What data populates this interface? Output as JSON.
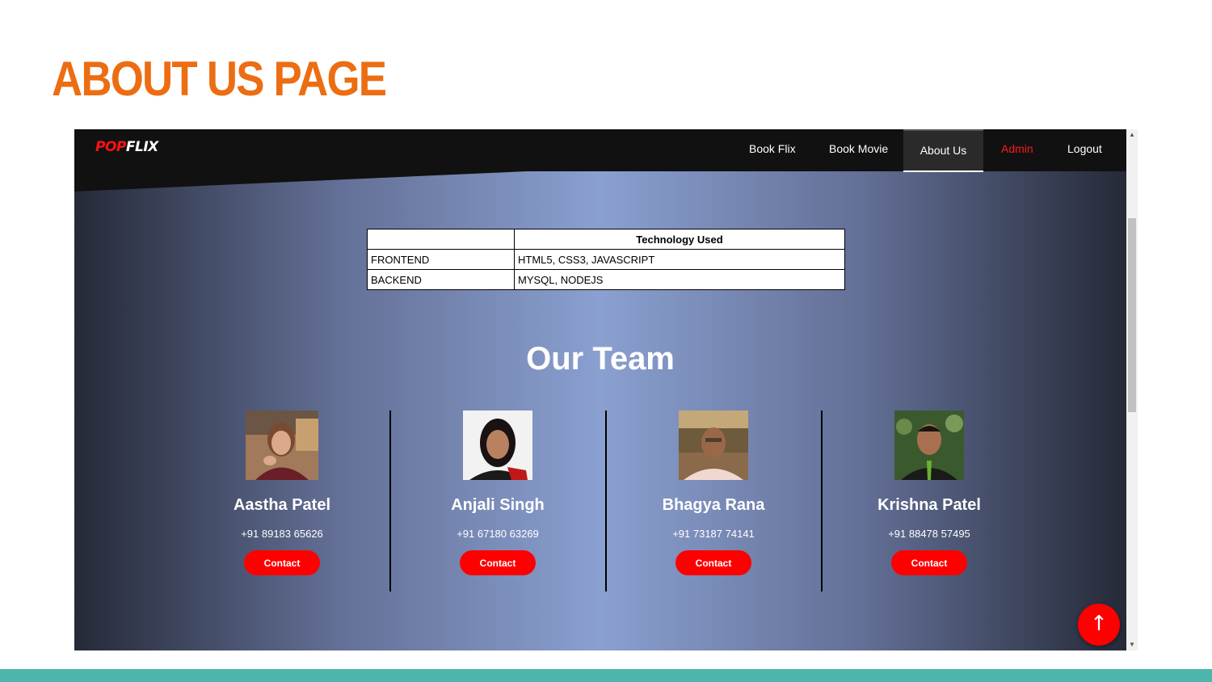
{
  "slide": {
    "title": "ABOUT US PAGE"
  },
  "nav": {
    "logo_red": "POP",
    "logo_white": "FLIX",
    "items": [
      {
        "label": "Book Flix"
      },
      {
        "label": "Book Movie"
      },
      {
        "label": "About Us",
        "active": true
      },
      {
        "label": "Admin",
        "color": "#ff1a1a"
      },
      {
        "label": "Logout"
      }
    ]
  },
  "tech_table": {
    "header": [
      "",
      "Technology Used"
    ],
    "rows": [
      [
        "FRONTEND",
        "HTML5, CSS3, JAVASCRIPT"
      ],
      [
        "BACKEND",
        "MYSQL, NODEJS"
      ]
    ]
  },
  "team": {
    "heading": "Our Team",
    "members": [
      {
        "name": "Aastha Patel",
        "phone": "+91 89183 65626",
        "contact_label": "Contact"
      },
      {
        "name": "Anjali Singh",
        "phone": "+91 67180 63269",
        "contact_label": "Contact"
      },
      {
        "name": "Bhagya Rana",
        "phone": "+91 73187 74141",
        "contact_label": "Contact"
      },
      {
        "name": "Krishna Patel",
        "phone": "+91 88478 57495",
        "contact_label": "Contact"
      }
    ]
  },
  "scroll_top_icon": "arrow-up-icon",
  "colors": {
    "title": "#ec6d12",
    "accent": "#ff0000",
    "footer_bar": "#4db6ac",
    "nav_bg": "#111111"
  }
}
